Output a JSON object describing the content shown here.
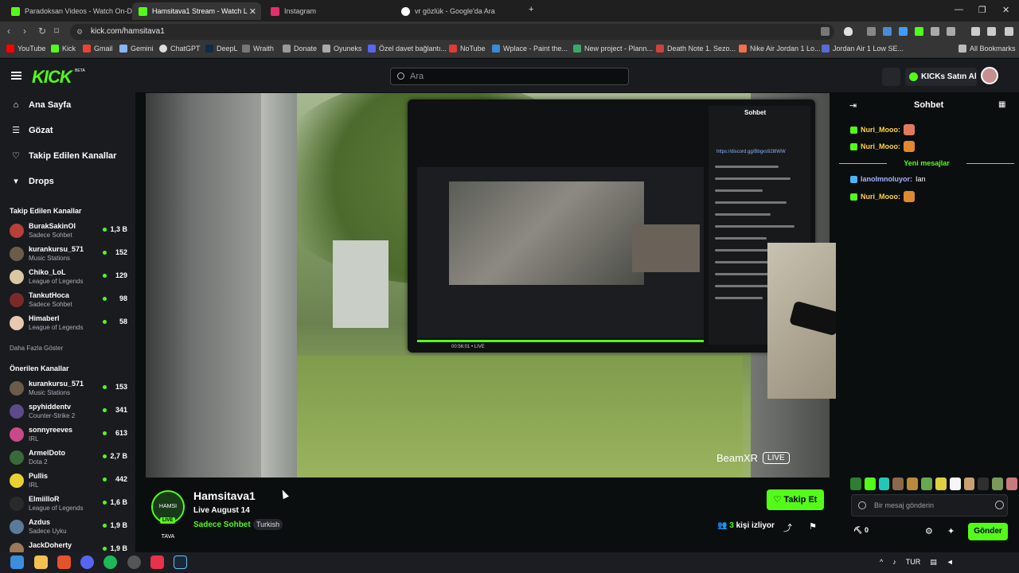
{
  "browser": {
    "tabs": [
      {
        "title": "Paradoksan Videos - Watch On-Dem",
        "favicon_color": "#53fc18"
      },
      {
        "title": "Hamsitava1 Stream - Watch L",
        "favicon_color": "#53fc18"
      },
      {
        "title": "Instagram",
        "favicon_color": "#e1306c"
      },
      {
        "title": "vr gözlük - Google'da Ara",
        "favicon_color": "#ffffff"
      }
    ],
    "url": "kick.com/hamsitava1",
    "bookmarks": [
      "YouTube",
      "Kick",
      "Gmail",
      "Gemini",
      "ChatGPT",
      "DeepL",
      "Wraith",
      "Donate",
      "Oyuneks",
      "Özel davet bağlantı...",
      "NoTube",
      "Wplace - Paint the...",
      "New project - Plann...",
      "Death Note 1. Sezo...",
      "Nike Air Jordan 1 Lo...",
      "Jordan Air 1 Low SE..."
    ],
    "all_bookmarks": "All Bookmarks"
  },
  "header": {
    "logo": "KICK",
    "beta": "BETA",
    "search_placeholder": "Ara",
    "kicks_button": "KICKs Satın Al"
  },
  "sidebar": {
    "nav": [
      {
        "label": "Ana Sayfa",
        "icon": "home-icon"
      },
      {
        "label": "Gözat",
        "icon": "browse-icon"
      },
      {
        "label": "Takip Edilen Kanallar",
        "icon": "heart-icon"
      },
      {
        "label": "Drops",
        "icon": "drops-icon"
      }
    ],
    "followed_title": "Takip Edilen Kanallar",
    "followed": [
      {
        "name": "BurakSakinOl",
        "category": "Sadece Sohbet",
        "viewers": "1,3 B",
        "color": "#b7403a"
      },
      {
        "name": "kurankursu_571",
        "category": "Music Stations",
        "viewers": "152",
        "color": "#6b5c4a"
      },
      {
        "name": "Chiko_LoL",
        "category": "League of Legends",
        "viewers": "129",
        "color": "#d9c7a3"
      },
      {
        "name": "TankutHoca",
        "category": "Sadece Sohbet",
        "viewers": "98",
        "color": "#7a2a2a"
      },
      {
        "name": "Himaberl",
        "category": "League of Legends",
        "viewers": "58",
        "color": "#e8c8b0"
      }
    ],
    "show_more": "Daha Fazla Göster",
    "recommended_title": "Önerilen Kanallar",
    "recommended": [
      {
        "name": "kurankursu_571",
        "category": "Music Stations",
        "viewers": "153",
        "color": "#6b5c4a"
      },
      {
        "name": "spyhiddentv",
        "category": "Counter-Strike 2",
        "viewers": "341",
        "color": "#5c4a8a"
      },
      {
        "name": "sonnyreeves",
        "category": "IRL",
        "viewers": "613",
        "color": "#c94a8a"
      },
      {
        "name": "ArmelDoto",
        "category": "Dota 2",
        "viewers": "2,7 B",
        "color": "#3a6a3a"
      },
      {
        "name": "Pullis",
        "category": "IRL",
        "viewers": "442",
        "color": "#e8d230"
      },
      {
        "name": "ElmiilloR",
        "category": "League of Legends",
        "viewers": "1,6 B",
        "color": "#2a2a2a"
      },
      {
        "name": "Azdus",
        "category": "Sadece Uyku",
        "viewers": "1,9 B",
        "color": "#5a7a9a"
      },
      {
        "name": "JackDoherty",
        "category": "",
        "viewers": "1,9 B",
        "color": "#9a7a5a"
      }
    ]
  },
  "video": {
    "overlay_brand": "BeamXR",
    "overlay_live": "LIVE",
    "vr_chat_title": "Sohbet",
    "vr_link": "https://discord.gg/Bbgxs92l8WW",
    "vr_time": "00:56:01 • LIVE"
  },
  "stream": {
    "channel": "Hamsitava1",
    "avatar_text": "HAMSI TAVA",
    "live_badge": "LIVE",
    "live_date": "Live August 14",
    "category": "Sadece Sohbet",
    "tag": "Turkish",
    "follow": "Takip Et",
    "viewer_count": "3",
    "viewers_label": "kişi izliyor"
  },
  "chat": {
    "title": "Sohbet",
    "messages": [
      {
        "user": "Nuri_Mooo:",
        "text": "",
        "badge": "green",
        "emote": true
      },
      {
        "user": "Nuri_Mooo:",
        "text": "",
        "badge": "green",
        "emote": true
      },
      {
        "user": "IanoImnoluyor:",
        "text": "Ian",
        "badge": "blue",
        "emote": false
      },
      {
        "user": "Nuri_Mooo:",
        "text": "",
        "badge": "green",
        "emote": true
      }
    ],
    "new_messages": "Yeni mesajlar",
    "emote_colors": [
      "#2e7d32",
      "#53fc18",
      "#1fc9b5",
      "#8a6a4a",
      "#b78a3a",
      "#6aa84f",
      "#e0d040",
      "#f5f5f5",
      "#c9a070",
      "#2f2f2f",
      "#7a9a5a",
      "#c97a7a"
    ],
    "input_placeholder": "Bir mesaj gönderin",
    "kicks": "0",
    "send": "Gönder"
  },
  "taskbar": {
    "lang": "TUR"
  }
}
